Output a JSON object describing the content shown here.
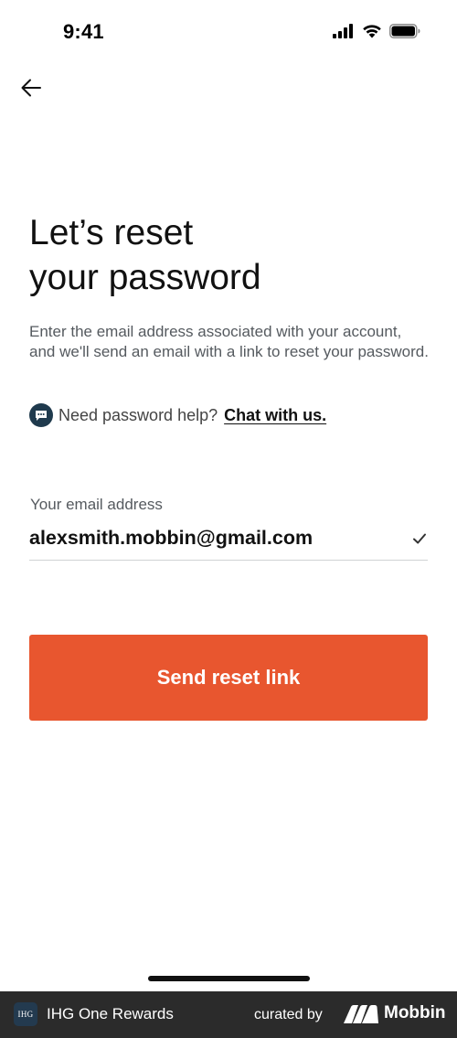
{
  "status_bar": {
    "time": "9:41"
  },
  "header": {
    "back_icon": "arrow-left-icon"
  },
  "main": {
    "title_line1": "Let’s reset",
    "title_line2": "your password",
    "description": "Enter the email address associated with your account, and we'll send an email with a link to reset your password.",
    "help_text": "Need password help?",
    "chat_link": "Chat with us.",
    "email_label": "Your email address",
    "email_value": "alexsmith.mobbin@gmail.com",
    "send_button_label": "Send reset link"
  },
  "footer": {
    "app_logo_text": "IHG",
    "app_name": "IHG One Rewards",
    "curated_by": "curated by",
    "brand": "Mobbin"
  },
  "colors": {
    "accent": "#e8562f",
    "chat_icon_bg": "#1f3a4d",
    "footer_bg": "#2b2b2b"
  }
}
